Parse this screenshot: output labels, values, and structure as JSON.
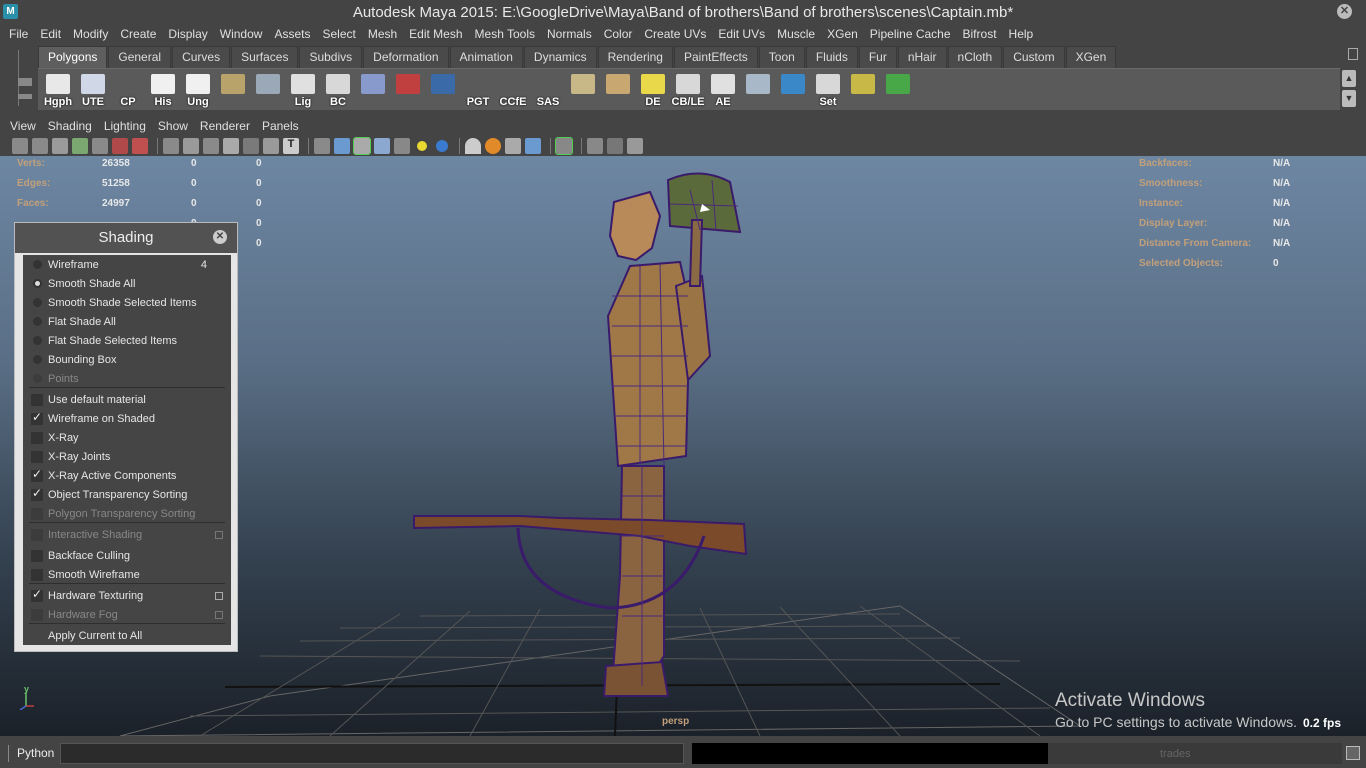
{
  "window": {
    "title": "Autodesk Maya 2015: E:\\GoogleDrive\\Maya\\Band of brothers\\Band of brothers\\scenes\\Captain.mb*",
    "app_icon_label": "M"
  },
  "menubar": {
    "items": [
      "File",
      "Edit",
      "Modify",
      "Create",
      "Display",
      "Window",
      "Assets",
      "Select",
      "Mesh",
      "Edit Mesh",
      "Mesh Tools",
      "Normals",
      "Color",
      "Create UVs",
      "Edit UVs",
      "Muscle",
      "XGen",
      "Pipeline Cache",
      "Bifrost",
      "Help"
    ]
  },
  "shelf": {
    "tabs": [
      "Polygons",
      "General",
      "Curves",
      "Surfaces",
      "Subdivs",
      "Deformation",
      "Animation",
      "Dynamics",
      "Rendering",
      "PaintEffects",
      "Toon",
      "Fluids",
      "Fur",
      "nHair",
      "nCloth",
      "Custom",
      "XGen"
    ],
    "active_tab": "Polygons",
    "buttons": [
      {
        "label": "Hgph",
        "icon": "window-icon",
        "color": "#e8e8e8"
      },
      {
        "label": "UTE",
        "icon": "window-icon",
        "color": "#d0d8e8"
      },
      {
        "label": "CP",
        "icon": "axis-icon",
        "color": "#5a5a5a"
      },
      {
        "label": "His",
        "icon": "script-icon",
        "color": "#f0f0f0"
      },
      {
        "label": "Ung",
        "icon": "script-icon",
        "color": "#f0f0f0"
      },
      {
        "label": "",
        "icon": "book-icon",
        "color": "#b8a46a"
      },
      {
        "label": "",
        "icon": "globe-icon",
        "color": "#9aa8b8"
      },
      {
        "label": "Lig",
        "icon": "window-icon",
        "color": "#e0e0e0"
      },
      {
        "label": "BC",
        "icon": "eye-icon",
        "color": "#d8d8d8"
      },
      {
        "label": "",
        "icon": "gizmo-icon",
        "color": "#8899cc"
      },
      {
        "label": "",
        "icon": "camera-icon",
        "color": "#c04040"
      },
      {
        "label": "",
        "icon": "curve-icon",
        "color": "#3a6aa8"
      },
      {
        "label": "PGT",
        "icon": "blank-icon",
        "color": "#5a5a5a"
      },
      {
        "label": "CCfE",
        "icon": "blank-icon",
        "color": "#5a5a5a"
      },
      {
        "label": "SAS",
        "icon": "blank-icon",
        "color": "#5a5a5a"
      },
      {
        "label": "",
        "icon": "uv-icon",
        "color": "#c8b888"
      },
      {
        "label": "",
        "icon": "uv-grid-icon",
        "color": "#c8a870"
      },
      {
        "label": "DE",
        "icon": "light-icon",
        "color": "#e8d84a"
      },
      {
        "label": "CB/LE",
        "icon": "eye-icon",
        "color": "#d8d8d8"
      },
      {
        "label": "AE",
        "icon": "window-icon",
        "color": "#e0e0e0"
      },
      {
        "label": "",
        "icon": "spotlight-icon",
        "color": "#a8b8c8"
      },
      {
        "label": "",
        "icon": "s-curve-icon",
        "color": "#3a88c8"
      },
      {
        "label": "Set",
        "icon": "key-icon",
        "color": "#d8d8d8"
      },
      {
        "label": "",
        "icon": "target-icon",
        "color": "#c8b848"
      },
      {
        "label": "",
        "icon": "target-color-icon",
        "color": "#48a848"
      }
    ]
  },
  "panel_menu": {
    "items": [
      "View",
      "Shading",
      "Lighting",
      "Show",
      "Renderer",
      "Panels"
    ]
  },
  "hud_left": {
    "rows": [
      {
        "label": "Verts:",
        "v1": "26358",
        "v2": "0",
        "v3": "0"
      },
      {
        "label": "Edges:",
        "v1": "51258",
        "v2": "0",
        "v3": "0"
      },
      {
        "label": "Faces:",
        "v1": "24997",
        "v2": "0",
        "v3": "0"
      },
      {
        "label": "",
        "v1": "",
        "v2": "0",
        "v3": "0"
      },
      {
        "label": "",
        "v1": "",
        "v2": "",
        "v3": "0"
      }
    ]
  },
  "hud_right": {
    "rows": [
      {
        "label": "Backfaces:",
        "value": "N/A"
      },
      {
        "label": "Smoothness:",
        "value": "N/A"
      },
      {
        "label": "Instance:",
        "value": "N/A"
      },
      {
        "label": "Display Layer:",
        "value": "N/A"
      },
      {
        "label": "Distance From Camera:",
        "value": "N/A"
      },
      {
        "label": "Selected Objects:",
        "value": "0"
      }
    ]
  },
  "viewport": {
    "camera_label": "persp",
    "axis_y": "y",
    "fps": "0.2 fps"
  },
  "shading_panel": {
    "title": "Shading",
    "items": [
      {
        "type": "radio",
        "label": "Wireframe",
        "on": false,
        "hotkey": "4",
        "disabled": false
      },
      {
        "type": "radio",
        "label": "Smooth Shade All",
        "on": true,
        "disabled": false
      },
      {
        "type": "radio",
        "label": "Smooth Shade Selected Items",
        "on": false,
        "disabled": false
      },
      {
        "type": "radio",
        "label": "Flat Shade All",
        "on": false,
        "disabled": false
      },
      {
        "type": "radio",
        "label": "Flat Shade Selected Items",
        "on": false,
        "disabled": false
      },
      {
        "type": "radio",
        "label": "Bounding Box",
        "on": false,
        "disabled": false
      },
      {
        "type": "radio",
        "label": "Points",
        "on": false,
        "disabled": true
      },
      {
        "type": "check",
        "label": "Use default material",
        "on": false,
        "disabled": false
      },
      {
        "type": "check",
        "label": "Wireframe on Shaded",
        "on": true,
        "disabled": false
      },
      {
        "type": "check",
        "label": "X-Ray",
        "on": false,
        "disabled": false
      },
      {
        "type": "check",
        "label": "X-Ray Joints",
        "on": false,
        "disabled": false
      },
      {
        "type": "check",
        "label": "X-Ray Active Components",
        "on": true,
        "disabled": false
      },
      {
        "type": "check",
        "label": "Object Transparency Sorting",
        "on": true,
        "disabled": false
      },
      {
        "type": "check",
        "label": "Polygon Transparency Sorting",
        "on": false,
        "disabled": true
      },
      {
        "type": "check",
        "label": "Interactive Shading",
        "on": false,
        "disabled": true,
        "option_box": true
      },
      {
        "type": "check",
        "label": "Backface Culling",
        "on": false,
        "disabled": false
      },
      {
        "type": "check",
        "label": "Smooth Wireframe",
        "on": false,
        "disabled": false
      },
      {
        "type": "check",
        "label": "Hardware Texturing",
        "on": true,
        "disabled": false,
        "option_box": true
      },
      {
        "type": "check",
        "label": "Hardware Fog",
        "on": false,
        "disabled": true,
        "option_box": true
      },
      {
        "type": "action",
        "label": "Apply Current to All",
        "disabled": false
      }
    ]
  },
  "watermark": {
    "line1": "Activate Windows",
    "line2": "Go to PC settings to activate Windows."
  },
  "command_line": {
    "label": "Python",
    "input_value": "",
    "right_text": "trades"
  }
}
